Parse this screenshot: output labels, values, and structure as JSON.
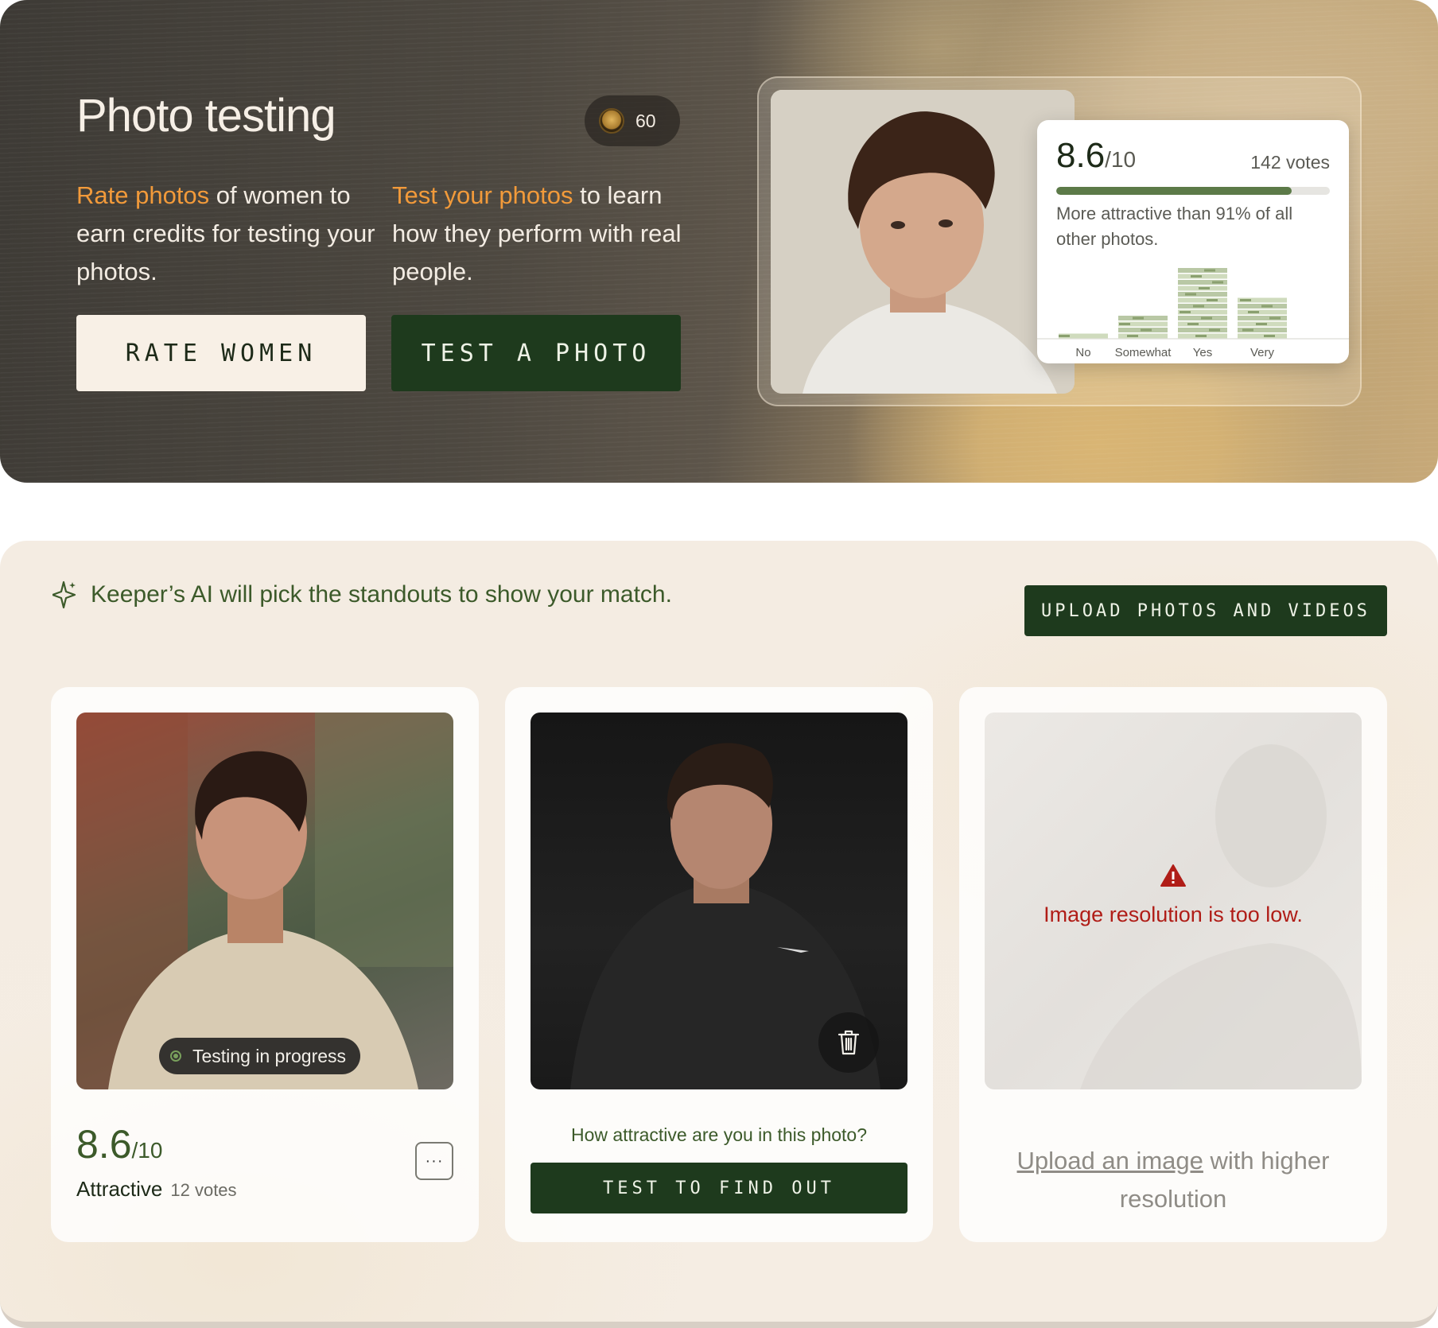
{
  "hero": {
    "title": "Photo testing",
    "credits": "60",
    "left_highlight": "Rate photos",
    "left_text": " of women to earn credits for testing your photos.",
    "right_highlight": "Test your photos",
    "right_text": " to learn how they perform with real people.",
    "rate_button": "RATE WOMEN",
    "test_button": "TEST A PHOTO"
  },
  "preview": {
    "score": "8.6",
    "score_denominator": "/10",
    "votes": "142 votes",
    "bar_fraction": 0.86,
    "description": "More attractive than 91% of all other photos.",
    "chart_categories": [
      "No",
      "Somewhat",
      "Yes",
      "Very"
    ],
    "chart_values": [
      1,
      4,
      12,
      7
    ]
  },
  "gallery": {
    "ai_note": "Keeper’s AI will pick the standouts to show your match.",
    "upload_button": "UPLOAD PHOTOS AND VIDEOS",
    "card1": {
      "badge": "Testing in progress",
      "score": "8.6",
      "score_denominator": "/10",
      "rating": "Attractive",
      "votes": "12 votes",
      "more_label": "···"
    },
    "card2": {
      "question": "How attractive are you in this photo?",
      "button": "TEST TO FIND OUT"
    },
    "card3": {
      "error": "Image resolution is too low.",
      "link_text": "Upload an image",
      "help_text": " with higher resolution"
    }
  },
  "colors": {
    "accent_orange": "#f29a3a",
    "dark_green": "#1e3a1d",
    "text_green": "#3c5a2a",
    "error_red": "#b01d17"
  }
}
